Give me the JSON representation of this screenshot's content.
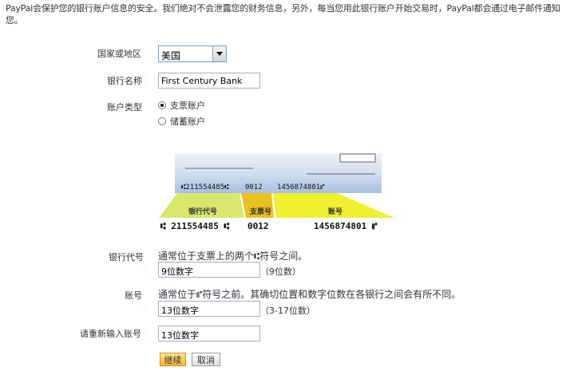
{
  "intro_text": "PayPal会保护您的银行账户信息的安全。我们绝对不会泄露您的财务信息，另外，每当您用此银行账户开始交易时，PayPal都会通过电子邮件通知您。",
  "form": {
    "country": {
      "label": "国家或地区",
      "value": "美国"
    },
    "bank_name": {
      "label": "银行名称",
      "value": "First Century Bank"
    },
    "account_type": {
      "label": "账户类型",
      "options": [
        "支票账户",
        "储蓄账户"
      ],
      "selected": 0
    },
    "routing": {
      "label": "银行代号",
      "hint": "通常位于支票上的两个⑆符号之间。",
      "value": "9位数字",
      "suffix": "（9位数）"
    },
    "account": {
      "label": "账号",
      "hint": "通常位于⑈符号之前。其确切位置和数字位数在各银行之间会有所不同。",
      "value": "13位数字",
      "suffix": "（3-17位数）"
    },
    "confirm_account": {
      "label": "请重新输入账号",
      "value": "13位数字"
    }
  },
  "check_image": {
    "check_line_micr": {
      "routing": "⑆211554485⑆",
      "check": "0012",
      "account": "1456874801⑈"
    },
    "bands": {
      "routing": "银行代号",
      "check": "支票号",
      "account": "账号"
    },
    "bottom_micr": {
      "routing": "⑆ 211554485 ⑆",
      "check": "0012",
      "account": "1456874801 ⑈"
    },
    "colors": {
      "check_bg": "#b8cbe8",
      "routing_band": "#d8e86c",
      "check_band": "#e8c020",
      "account_band": "#eef030"
    }
  },
  "buttons": {
    "continue": "继续",
    "cancel": "取消"
  }
}
